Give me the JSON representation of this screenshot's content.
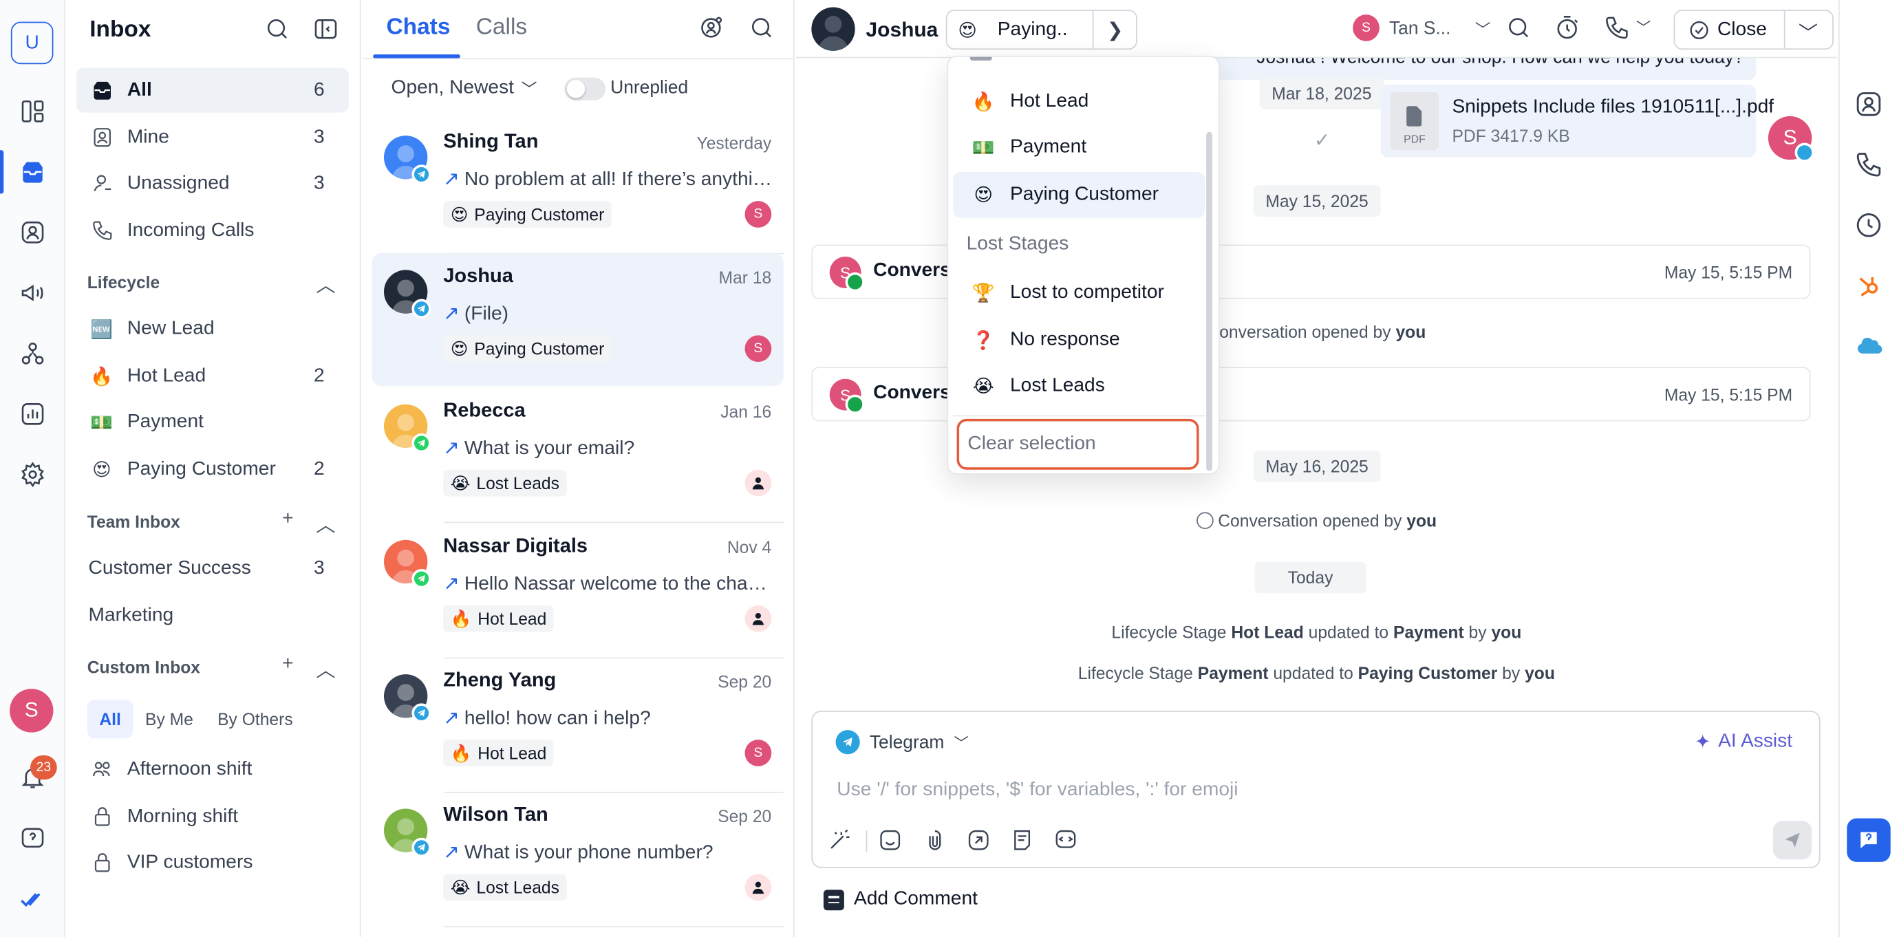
{
  "workspace": {
    "initial": "U"
  },
  "rail": {
    "user_initial": "S",
    "notifications": "23"
  },
  "nav": {
    "title": "Inbox",
    "items": [
      {
        "label": "All",
        "count": "6"
      },
      {
        "label": "Mine",
        "count": "3"
      },
      {
        "label": "Unassigned",
        "count": "3"
      },
      {
        "label": "Incoming Calls",
        "count": ""
      }
    ],
    "lifecycle": {
      "title": "Lifecycle",
      "items": [
        {
          "emoji": "🆕",
          "label": "New Lead",
          "count": ""
        },
        {
          "emoji": "🔥",
          "label": "Hot Lead",
          "count": "2"
        },
        {
          "emoji": "💵",
          "label": "Payment",
          "count": ""
        },
        {
          "emoji": "😍",
          "label": "Paying Customer",
          "count": "2"
        }
      ]
    },
    "team_inbox": {
      "title": "Team Inbox",
      "items": [
        {
          "label": "Customer Success",
          "count": "3"
        },
        {
          "label": "Marketing",
          "count": ""
        }
      ]
    },
    "custom_inbox": {
      "title": "Custom Inbox",
      "filters": [
        "All",
        "By Me",
        "By Others"
      ],
      "items": [
        {
          "label": "Afternoon shift"
        },
        {
          "label": "Morning shift"
        },
        {
          "label": "VIP customers"
        }
      ]
    }
  },
  "list": {
    "tabs": [
      "Chats",
      "Calls"
    ],
    "filter": "Open, Newest",
    "unreplied": "Unreplied",
    "chats": [
      {
        "name": "Shing Tan",
        "date": "Yesterday",
        "preview": "No problem at all! If there’s anything else I can help you with",
        "tag_emoji": "😍",
        "tag": "Paying Customer",
        "assignee": "S",
        "channel": "telegram"
      },
      {
        "name": "Joshua",
        "date": "Mar 18",
        "preview": "(File)",
        "tag_emoji": "😍",
        "tag": "Paying Customer",
        "assignee": "S",
        "channel": "telegram"
      },
      {
        "name": "Rebecca",
        "date": "Jan 16",
        "preview": "What is your email?",
        "tag_emoji": "😭",
        "tag": "Lost Leads",
        "assignee": "",
        "channel": "whatsapp"
      },
      {
        "name": "Nassar Digitals",
        "date": "Nov 4",
        "preview": "Hello Nassar welcome to the channel",
        "tag_emoji": "🔥",
        "tag": "Hot Lead",
        "assignee": "",
        "channel": "whatsapp"
      },
      {
        "name": "Zheng Yang",
        "date": "Sep 20",
        "preview": "hello! how can i help?",
        "tag_emoji": "🔥",
        "tag": "Hot Lead",
        "assignee": "S",
        "channel": "telegram"
      },
      {
        "name": "Wilson Tan",
        "date": "Sep 20",
        "preview": "What is your phone number?",
        "tag_emoji": "😭",
        "tag": "Lost Leads",
        "assignee": "",
        "channel": "telegram"
      }
    ]
  },
  "conversation": {
    "contact": "Joshua",
    "stage_emoji": "😍",
    "stage": "Paying..",
    "assignee_initial": "S",
    "assignee": "Tan S...",
    "close_label": "Close",
    "top_message": "Joshua ! Welcome to our shop. How can we help you today?",
    "file": {
      "name": "Snippets Include files 1910511[...].pdf",
      "meta": "PDF  3417.9 KB",
      "ext": "PDF",
      "date": "Mar 18, 2025"
    },
    "self_initial": "S",
    "dates": [
      "May 15, 2025",
      "May 16, 2025",
      "Today"
    ],
    "events": [
      {
        "title": "Conversation closed",
        "date": "May 15, 5:15 PM"
      },
      {
        "title": "Conversation closed",
        "date": "May 15, 5:15 PM"
      }
    ],
    "opened_1": {
      "prefix": "Conversation opened by",
      "by": "you"
    },
    "opened_2": {
      "prefix": "Conversation opened by",
      "by": "you"
    },
    "lifecycle_1": {
      "a": "Lifecycle Stage",
      "from": "Hot Lead",
      "b": "updated to",
      "to": "Payment",
      "c": "by",
      "by": "you"
    },
    "lifecycle_2": {
      "a": "Lifecycle Stage",
      "from": "Payment",
      "b": "updated to",
      "to": "Paying Customer",
      "c": "by",
      "by": "you"
    },
    "composer": {
      "channel": "Telegram",
      "ai_assist": "AI Assist",
      "placeholder": "Use '/' for snippets, '$' for variables, ':' for emoji"
    },
    "add_comment": "Add Comment"
  },
  "dropdown": {
    "items": [
      {
        "emoji": "🔥",
        "label": "Hot Lead"
      },
      {
        "emoji": "💵",
        "label": "Payment"
      },
      {
        "emoji": "😍",
        "label": "Paying Customer",
        "selected": true
      }
    ],
    "lost_section": "Lost Stages",
    "lost_items": [
      {
        "emoji": "🏆",
        "label": "Lost to competitor"
      },
      {
        "emoji": "❓",
        "label": "No response"
      },
      {
        "emoji": "😭",
        "label": "Lost Leads"
      }
    ],
    "clear": "Clear selection"
  },
  "colors": {
    "accent": "#2563eb",
    "avatar": "#e0517a",
    "highlight": "#e35d3c"
  }
}
